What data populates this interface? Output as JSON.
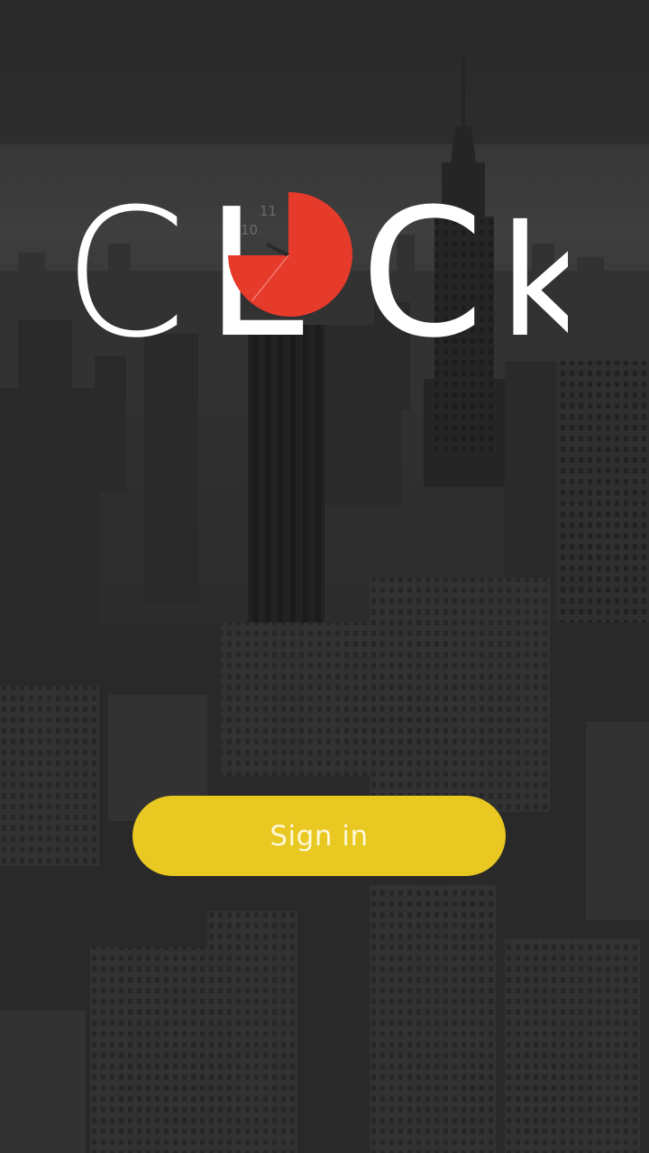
{
  "app": {
    "logo": {
      "letters": [
        "C",
        "L",
        "C",
        "k"
      ],
      "clock_face_numerals": [
        "10",
        "11"
      ],
      "accent_color": "#e63a2b"
    },
    "background": "city-skyline-photo",
    "signin": {
      "label": "Sign in",
      "color": "#e8c821"
    }
  }
}
